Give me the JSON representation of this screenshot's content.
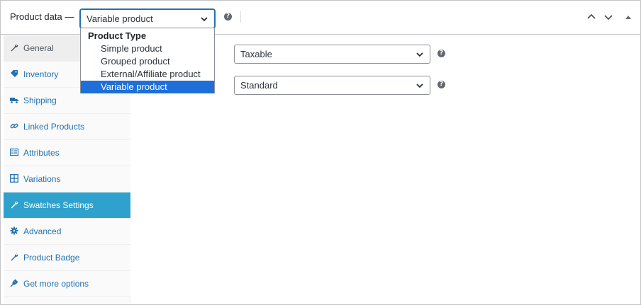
{
  "header": {
    "title": "Product data —",
    "product_type_value": "Variable product"
  },
  "dropdown": {
    "group_label": "Product Type",
    "options": [
      "Simple product",
      "Grouped product",
      "External/Affiliate product",
      "Variable product"
    ],
    "selected": "Variable product"
  },
  "tabs": [
    {
      "label": "General",
      "icon": "wrench-icon"
    },
    {
      "label": "Inventory",
      "icon": "tag-icon"
    },
    {
      "label": "Shipping",
      "icon": "truck-icon"
    },
    {
      "label": "Linked Products",
      "icon": "link-icon"
    },
    {
      "label": "Attributes",
      "icon": "list-icon"
    },
    {
      "label": "Variations",
      "icon": "grid-icon"
    },
    {
      "label": "Swatches Settings",
      "icon": "wrench-icon"
    },
    {
      "label": "Advanced",
      "icon": "gear-icon"
    },
    {
      "label": "Product Badge",
      "icon": "wrench-icon"
    },
    {
      "label": "Get more options",
      "icon": "plug-icon"
    }
  ],
  "active_tab": "Swatches Settings",
  "fields": {
    "tax_status_value": "Taxable",
    "tax_class_value": "Standard"
  },
  "colors": {
    "accent": "#2271b1",
    "active_tab": "#2ea2cc",
    "selected_option": "#1e6fd9"
  }
}
